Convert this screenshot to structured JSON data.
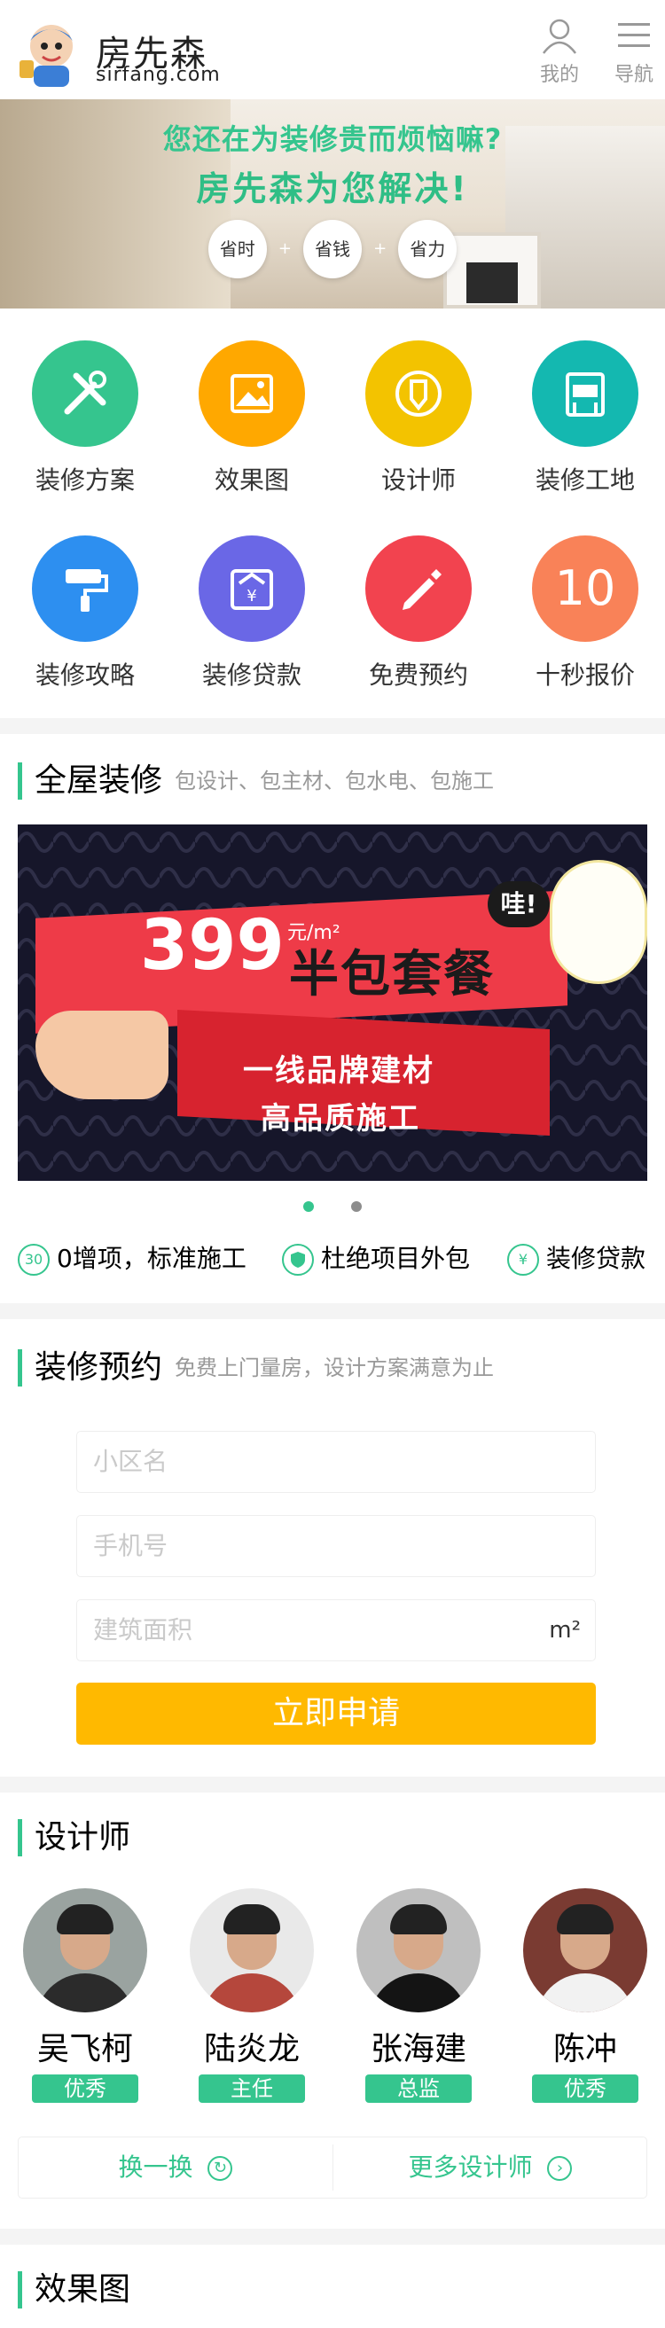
{
  "header": {
    "logo_cn": "房先森",
    "logo_en": "sirfang.com",
    "me_label": "我的",
    "nav_label": "导航"
  },
  "banner": {
    "line1": "您还在为装修贵而烦恼嘛?",
    "line2": "房先森为您解决!",
    "pills": [
      "省时",
      "省钱",
      "省力"
    ]
  },
  "grid": {
    "items": [
      {
        "label": "装修方案",
        "color": "#35c58e",
        "icon": "tools-icon"
      },
      {
        "label": "效果图",
        "color": "#ffa800",
        "icon": "image-icon"
      },
      {
        "label": "设计师",
        "color": "#f3c300",
        "icon": "pen-icon"
      },
      {
        "label": "装修工地",
        "color": "#14b8b0",
        "icon": "site-icon"
      },
      {
        "label": "装修攻略",
        "color": "#2d8ff0",
        "icon": "roller-icon"
      },
      {
        "label": "装修贷款",
        "color": "#6a67e6",
        "icon": "loan-icon"
      },
      {
        "label": "免费预约",
        "color": "#f2434f",
        "icon": "pencil-icon"
      },
      {
        "label": "十秒报价",
        "color": "#f98258",
        "icon": "ten-icon",
        "text": "10"
      }
    ]
  },
  "whole_house": {
    "title": "全屋装修",
    "subtitle": "包设计、包主材、包水电、包施工"
  },
  "promo": {
    "price": "399",
    "unit": "元/m²",
    "package": "半包套餐",
    "wa": "哇!",
    "line1": "一线品牌建材",
    "line2": "高品质施工"
  },
  "features": [
    {
      "icon": "30",
      "label": "0增项，标准施工"
    },
    {
      "icon": "shield",
      "label": "杜绝项目外包"
    },
    {
      "icon": "¥",
      "label": "装修贷款"
    }
  ],
  "booking": {
    "title": "装修预约",
    "subtitle": "免费上门量房，设计方案满意为止",
    "community_placeholder": "小区名",
    "phone_placeholder": "手机号",
    "area_placeholder": "建筑面积",
    "area_unit": "m²",
    "submit": "立即申请"
  },
  "designers": {
    "title": "设计师",
    "list": [
      {
        "name": "吴飞柯",
        "rank": "优秀"
      },
      {
        "name": "陆炎龙",
        "rank": "主任"
      },
      {
        "name": "张海建",
        "rank": "总监"
      },
      {
        "name": "陈冲",
        "rank": "优秀"
      }
    ],
    "refresh": "换一换",
    "more": "更多设计师"
  },
  "effects": {
    "title": "效果图"
  }
}
